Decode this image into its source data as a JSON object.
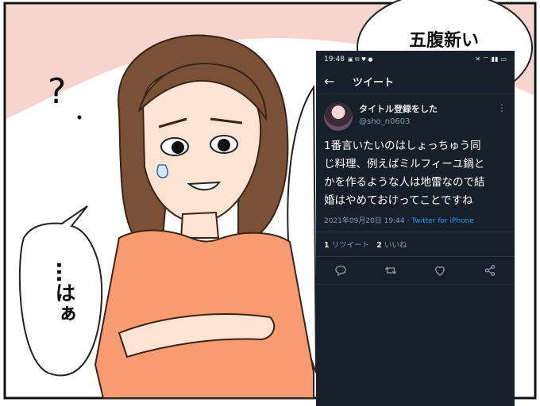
{
  "manga": {
    "question_mark": "?",
    "bubble_left_text": "…はぁ",
    "bubble_top_text": "五腹新い"
  },
  "phone": {
    "status": {
      "time": "19:48"
    },
    "header": {
      "title": "ツイート"
    },
    "tweet": {
      "display_name": "タイトル登録をした",
      "handle": "@sho_n0603",
      "lines": [
        "1番言いたいのはしょっちゅう同",
        "じ料理、例えばミルフィーユ鍋と",
        "かを作るような人は地雷なので結",
        "婚はやめておけってことですね"
      ],
      "timestamp": "2021年09月20日 19:44",
      "separator": " · ",
      "client": "Twitter for iPhone",
      "retweet_count": "1",
      "retweet_label": "リツイート",
      "like_count": "2",
      "like_label": "いいね"
    },
    "icons": [
      "back-arrow-icon",
      "more-icon",
      "reply-icon",
      "retweet-icon",
      "like-icon",
      "share-icon"
    ],
    "colors": {
      "background": "#15202b",
      "accent": "#1d9bf0",
      "secondary_text": "#8b98a5"
    }
  }
}
